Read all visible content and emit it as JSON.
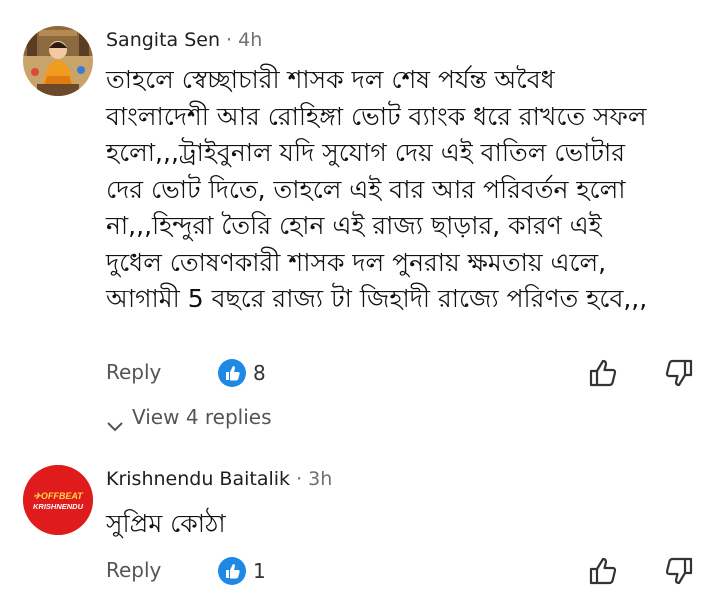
{
  "comments": [
    {
      "author": "Sangita Sen",
      "separator": " · ",
      "age": "4h",
      "avatar_icon": "illustrated-figure-avatar",
      "text_lines": [
        "তাহলে স্বেচ্ছাচারী শাসক দল শেষ পর্যন্ত অবৈধ",
        "বাংলাদেশী আর রোহিঙ্গা ভোট ব্যাংক ধরে রাখতে সফল",
        "হলো,,,ট্রাইবুনাল যদি সুযোগ দেয় এই বাতিল ভোটার",
        "দের ভোট দিতে, তাহলে এই বার আর পরিবর্তন হলো",
        "না,,,হিন্দুরা তৈরি হোন এই রাজ্য ছাড়ার, কারণ এই",
        "দুধেল তোষণকারী শাসক দল পুনরায় ক্ষমতায় এলে,",
        "আগামী 5 বছরে রাজ্য টা জিহাদী রাজ্যে পরিণত হবে,,,"
      ],
      "reply_label": "Reply",
      "like_count": "8",
      "view_replies_label": "View 4 replies"
    },
    {
      "author": "Krishnendu Baitalik",
      "separator": " · ",
      "age": "3h",
      "avatar_logo_text": [
        "OFFBEAT",
        "KRISHNENDU"
      ],
      "text_lines": [
        "সুপ্রিম কোঠা"
      ],
      "reply_label": "Reply",
      "like_count": "1"
    }
  ],
  "colors": {
    "like_badge": "#1e88e5",
    "avatar2_bg": "#e01b1b",
    "avatar2_text": "#ffd54a"
  }
}
